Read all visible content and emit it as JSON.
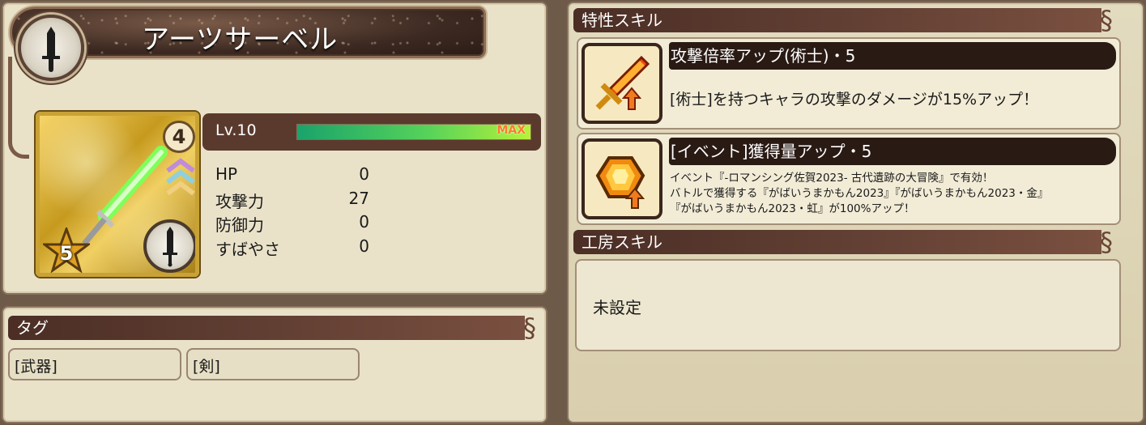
{
  "weapon": {
    "name": "アーツサーベル",
    "star_rank": "5",
    "awaken_level": "4",
    "level_label": "Lv.10",
    "level_progress": 1.0,
    "max_label": "MAX",
    "stats": [
      {
        "label": "HP",
        "value": "0"
      },
      {
        "label": "攻撃力",
        "value": "27"
      },
      {
        "label": "防御力",
        "value": "0"
      },
      {
        "label": "すばやさ",
        "value": "0"
      }
    ]
  },
  "tags": {
    "header": "タグ",
    "items": [
      "[武器]",
      "[剣]"
    ]
  },
  "traits": {
    "header": "特性スキル",
    "skills": [
      {
        "name": "攻撃倍率アップ(術士)・5",
        "icon": "flaming-sword-icon",
        "desc": "[術士]を持つキャラの攻撃のダメージが15%アップ！"
      },
      {
        "name": "[イベント]獲得量アップ・5",
        "icon": "orange-gem-icon",
        "desc_lines": [
          "イベント『-ロマンシング佐賀2023- 古代遺跡の大冒険』で有効！",
          "バトルで獲得する『がばいうまかもん2023』『がばいうまかもん2023・金』",
          "『がばいうまかもん2023・虹』が100%アップ！"
        ]
      }
    ]
  },
  "workshop": {
    "header": "工房スキル",
    "value": "未設定"
  },
  "colors": {
    "panel_bg": "#e9e2c9",
    "header_bg": "#4b2e25",
    "bar_fill": "#55d25a",
    "max_text": "#ff7a30"
  }
}
